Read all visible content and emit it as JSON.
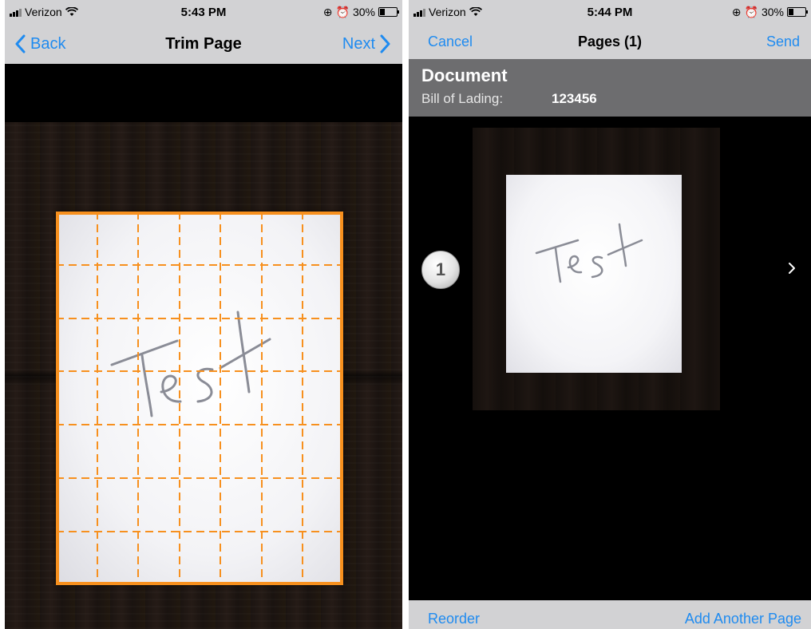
{
  "left_screen": {
    "status": {
      "carrier": "Verizon",
      "time": "5:43 PM",
      "battery": "30%"
    },
    "nav": {
      "back_label": "Back",
      "title": "Trim Page",
      "next_label": "Next"
    },
    "paper_text": "Test"
  },
  "right_screen": {
    "status": {
      "carrier": "Verizon",
      "time": "5:44 PM",
      "battery": "30%"
    },
    "nav": {
      "cancel_label": "Cancel",
      "title": "Pages (1)",
      "send_label": "Send"
    },
    "document": {
      "title": "Document",
      "field_label": "Bill of Lading:",
      "field_value": "123456"
    },
    "page_number": "1",
    "paper_text": "Test",
    "bottom": {
      "reorder_label": "Reorder",
      "add_page_label": "Add Another Page"
    }
  },
  "colors": {
    "accent": "#1f8bf0",
    "trim": "#f7901e",
    "bar": "#d2d2d4",
    "header": "#6d6d6f"
  },
  "battery_level": 0.3
}
